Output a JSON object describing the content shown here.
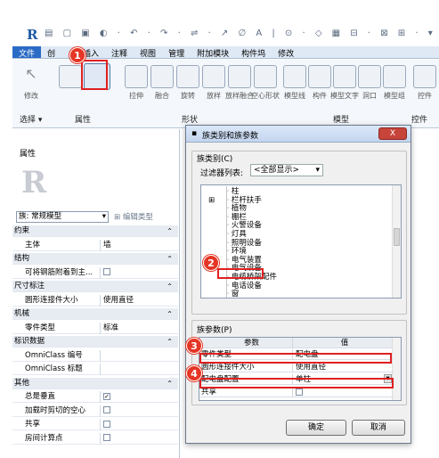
{
  "app": {
    "logo": "R"
  },
  "tabs": [
    "文件",
    "创",
    "插入",
    "注释",
    "视图",
    "管理",
    "附加模块",
    "构件坞",
    "修改"
  ],
  "ribbon": {
    "buttons": [
      "修改",
      "",
      "拉伸",
      "融合",
      "旋转",
      "放样",
      "放样融合",
      "空心形状",
      "模型线",
      "构件",
      "模型文字",
      "洞口",
      "模型组",
      "控件"
    ],
    "groups": {
      "select": "选择 ▾",
      "props": "属性",
      "form": "形状",
      "model": "模型",
      "ctrl": "控件"
    }
  },
  "properties": {
    "title": "属性",
    "family_label": "族: 常规模型",
    "edit_type": "编辑类型",
    "rows": [
      {
        "type": "hdr",
        "k": "约束"
      },
      {
        "k": "主体",
        "v": "墙"
      },
      {
        "type": "hdr",
        "k": "结构"
      },
      {
        "k": "可将钢筋附着到主...",
        "cb": ""
      },
      {
        "type": "hdr",
        "k": "尺寸标注"
      },
      {
        "k": "圆形连接件大小",
        "v": "使用直径"
      },
      {
        "type": "hdr",
        "k": "机械"
      },
      {
        "k": "零件类型",
        "v": "标准"
      },
      {
        "type": "hdr",
        "k": "标识数据"
      },
      {
        "k": "OmniClass 编号",
        "v": ""
      },
      {
        "k": "OmniClass 标题",
        "v": ""
      },
      {
        "type": "hdr",
        "k": "其他"
      },
      {
        "k": "总是垂直",
        "cb": "✓"
      },
      {
        "k": "加载时剪切的空心",
        "cb": ""
      },
      {
        "k": "共享",
        "cb": ""
      },
      {
        "k": "房间计算点",
        "cb": ""
      }
    ]
  },
  "dialog": {
    "title": "族类别和族参数",
    "close": "X",
    "category_group": "族类别(C)",
    "filter_label": "过滤器列表:",
    "filter_value": "<全部显示>",
    "categories": [
      "柱",
      "栏杆扶手",
      "植物",
      "棚栏",
      "火警设备",
      "灯具",
      "照明设备",
      "环境",
      "电气装置",
      "电气设备",
      "电缆桥架配件",
      "电话设备",
      "窗"
    ],
    "params_group": "族参数(P)",
    "param_header": {
      "k": "参数",
      "v": "值"
    },
    "params": [
      {
        "k": "零件类型",
        "v": "配电盘"
      },
      {
        "k": "圆形连接件大小",
        "v": "使用直径"
      },
      {
        "k": "配电盘配置",
        "v": "单柱"
      },
      {
        "k": "共享",
        "v": ""
      }
    ],
    "ok": "确定",
    "cancel": "取消"
  },
  "badges": [
    "1",
    "2",
    "3",
    "4"
  ]
}
